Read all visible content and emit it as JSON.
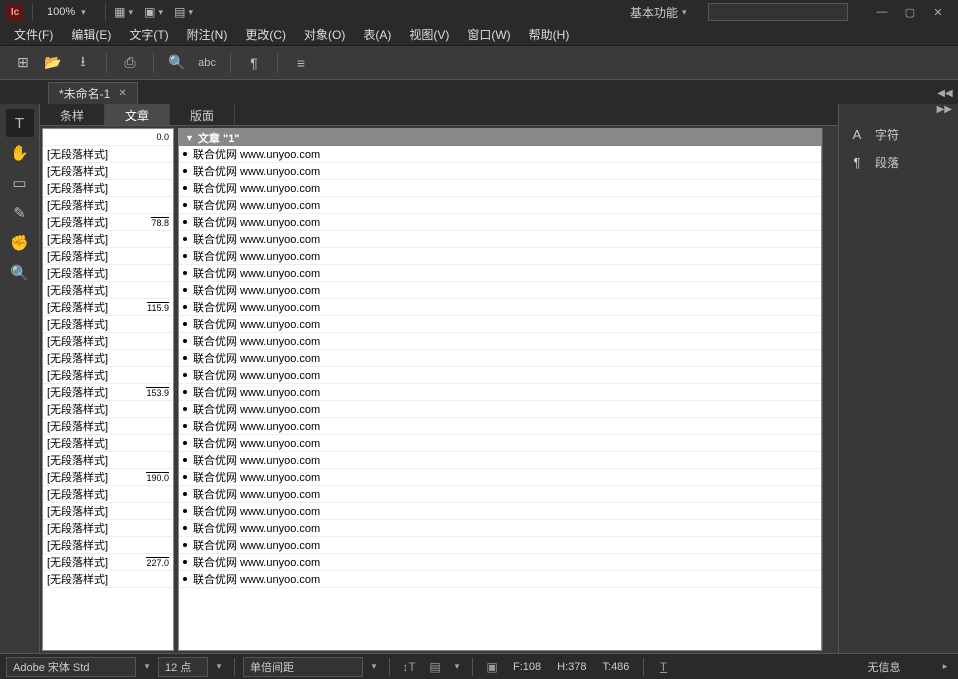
{
  "app": {
    "logo": "Ic"
  },
  "titlebar": {
    "zoom": "100%",
    "workspace_label": "基本功能"
  },
  "menu": [
    "文件(F)",
    "编辑(E)",
    "文字(T)",
    "附注(N)",
    "更改(C)",
    "对象(O)",
    "表(A)",
    "视图(V)",
    "窗口(W)",
    "帮助(H)"
  ],
  "doc_tab": {
    "name": "*未命名-1"
  },
  "subtabs": {
    "items": [
      "条样",
      "文章",
      "版面"
    ],
    "active_index": 1
  },
  "struct": {
    "left_style": "[无段落样式]",
    "markers": [
      "0.0",
      "78.8",
      "115.9",
      "153.9",
      "190.0",
      "227.0"
    ],
    "article_header": "文章 \"1\"",
    "content_line": "联合优网 www.unyoo.com",
    "row_count": 26
  },
  "right_panel": {
    "items": [
      {
        "icon": "A",
        "label": "字符"
      },
      {
        "icon": "¶",
        "label": "段落"
      }
    ]
  },
  "status": {
    "font": "Adobe 宋体 Std",
    "size": "12 点",
    "leading": "单倍间距",
    "f_label": "F:",
    "f_val": "108",
    "h_label": "H:",
    "h_val": "378",
    "t_label": "T:",
    "t_val": "486",
    "info": "无信息"
  }
}
